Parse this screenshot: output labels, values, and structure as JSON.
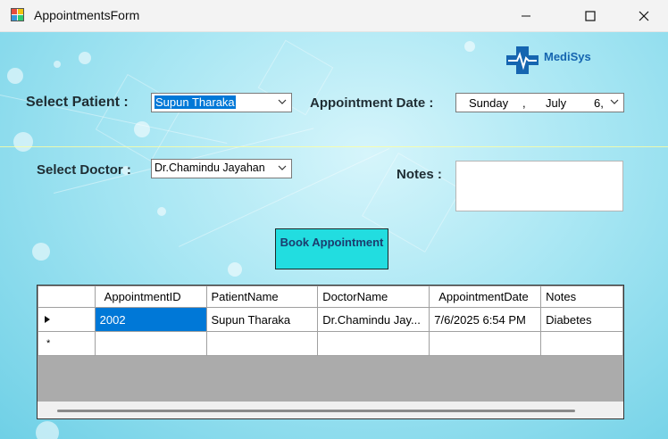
{
  "window": {
    "title": "AppointmentsForm"
  },
  "brand": {
    "name": "MediSys",
    "colors": {
      "brand": "#1565b0",
      "button": "#22dde0",
      "selection": "#0078d7"
    }
  },
  "form": {
    "patient_label": "Select Patient :",
    "patient_value": "Supun Tharaka",
    "date_label": "Appointment Date :",
    "date_weekday": "Sunday",
    "date_sep": ",",
    "date_month": "July",
    "date_day": "6,",
    "doctor_label": "Select Doctor :",
    "doctor_value": "Dr.Chamindu Jayahan",
    "notes_label": "Notes :",
    "notes_value": "",
    "book_button": "Book Appointment"
  },
  "grid": {
    "columns": [
      "AppointmentID",
      "PatientName",
      "DoctorName",
      "AppointmentDate",
      "Notes"
    ],
    "rows": [
      [
        "2002",
        "Supun Tharaka",
        "Dr.Chamindu Jay...",
        "7/6/2025 6:54 PM",
        "Diabetes"
      ]
    ],
    "new_row_marker": "*"
  }
}
